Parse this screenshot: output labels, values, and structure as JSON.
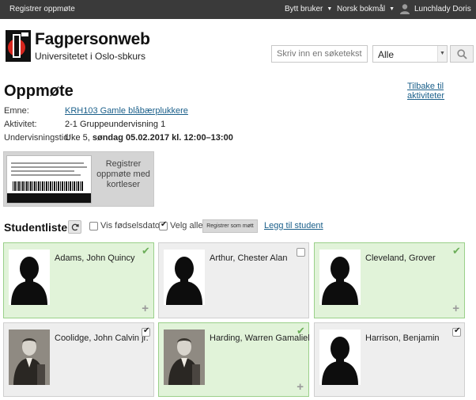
{
  "topbar": {
    "register": "Registrer oppmøte",
    "switch_user": "Bytt bruker",
    "language": "Norsk bokmål",
    "user": "Lunchlady Doris"
  },
  "header": {
    "title": "Fagpersonweb",
    "subtitle": "Universitetet i Oslo-sbkurs",
    "search_placeholder": "Skriv inn en søketekst",
    "search_scope": "Alle"
  },
  "page": {
    "title": "Oppmøte",
    "back_link": "Tilbake til aktiviteter",
    "subject_label": "Emne:",
    "subject_value": "KRH103 Gamle blåbærplukkere",
    "activity_label": "Aktivitet:",
    "activity_value": "2-1 Gruppeundervisning 1",
    "time_label": "Undervisningstid:",
    "time_week": "Uke 5, ",
    "time_bold": "søndag 05.02.2017 kl. 12:00–13:00"
  },
  "card_reader": {
    "label": "Registrer oppmøte med kortleser"
  },
  "studentlist": {
    "title": "Studentliste",
    "show_birthdate": "Vis fødselsdato",
    "select_all": "Velg alle",
    "register_present": "Registrer som møtt",
    "add_student": "Legg til student"
  },
  "students": [
    {
      "name": "Adams, John Quincy",
      "present": true,
      "photo": "silhouette"
    },
    {
      "name": "Arthur, Chester Alan",
      "present": false,
      "photo": "silhouette"
    },
    {
      "name": "Cleveland, Grover",
      "present": true,
      "photo": "silhouette"
    },
    {
      "name": "Coolidge, John Calvin jr.",
      "present": false,
      "photo": "portrait"
    },
    {
      "name": "Harding, Warren Gamaliel",
      "present": true,
      "photo": "portrait"
    },
    {
      "name": "Harrison, Benjamin",
      "present": false,
      "photo": "silhouette"
    }
  ],
  "colors": {
    "topbar": "#3a3a3a",
    "present_bg": "#e1f3d9",
    "absent_bg": "#eeeeee",
    "link": "#1a5f8a"
  }
}
